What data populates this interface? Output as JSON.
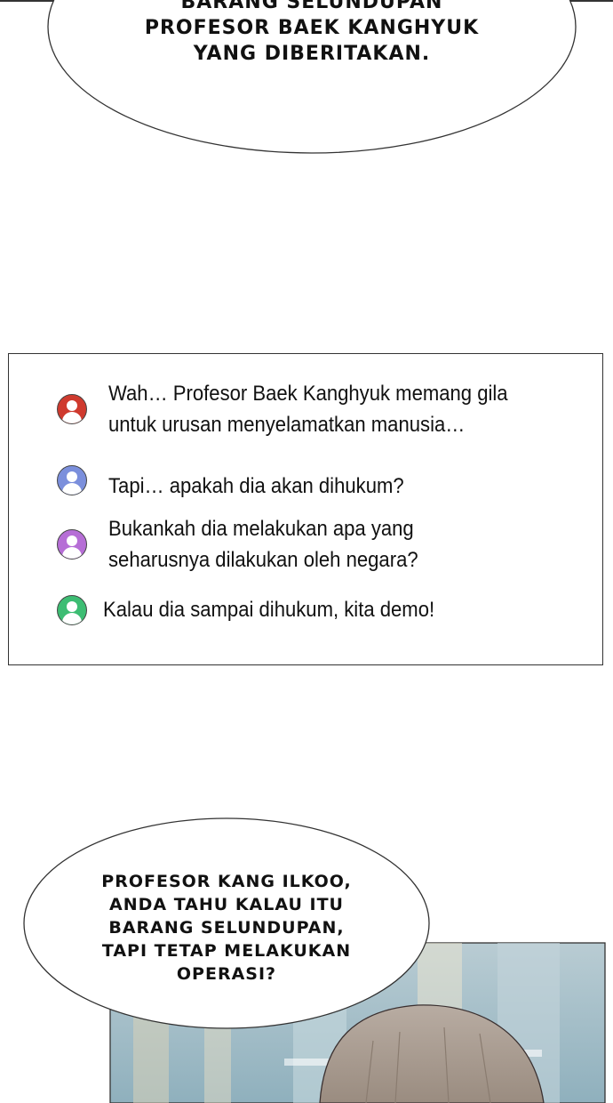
{
  "top_bubble": {
    "lines": [
      "BARANG SELUNDUPAN",
      "PROFESOR BAEK KANGHYUK",
      "YANG DIBERITAKAN."
    ]
  },
  "comments": [
    {
      "avatar_color": "#cf3a2e",
      "lines": [
        "Wah… Profesor Baek Kanghyuk memang gila",
        "untuk urusan menyelamatkan manusia…"
      ]
    },
    {
      "avatar_color": "#7b8fdc",
      "lines": [
        "Tapi… apakah dia akan dihukum?"
      ]
    },
    {
      "avatar_color": "#b66ed6",
      "lines": [
        "Bukankah dia melakukan apa yang",
        "seharusnya dilakukan oleh negara?"
      ]
    },
    {
      "avatar_color": "#3dbd73",
      "lines": [
        "Kalau dia sampai dihukum, kita demo!"
      ]
    }
  ],
  "bottom_bubble": {
    "lines": [
      "PROFESOR KANG ILKOO,",
      "ANDA TAHU KALAU ITU",
      "BARANG SELUNDUPAN,",
      "TAPI TETAP MELAKUKAN",
      "OPERASI?"
    ]
  }
}
